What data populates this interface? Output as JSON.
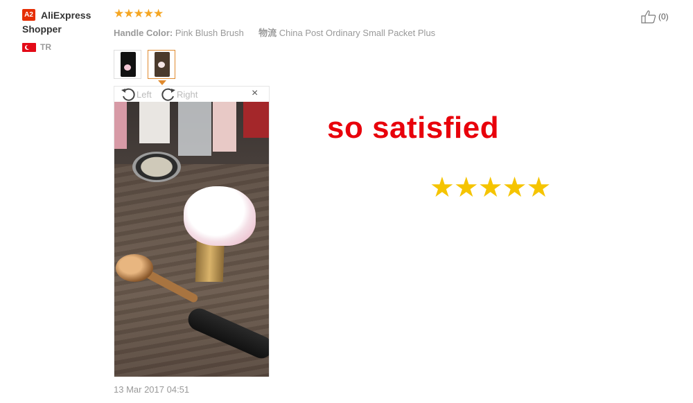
{
  "reviewer": {
    "badge": "A2",
    "name": "AliExpress Shopper",
    "country_code": "TR"
  },
  "review": {
    "stars": "★★★★★",
    "rating": 5,
    "attr_key": "Handle Color:",
    "attr_value": "Pink Blush Brush",
    "logistics_key": "物流",
    "logistics_value": "China Post Ordinary Small Packet Plus",
    "date": "13 Mar 2017 04:51"
  },
  "helpful": {
    "count": "(0)",
    "icon": "thumbs-up-icon"
  },
  "viewer": {
    "rotate_left": "Left",
    "rotate_right": "Right",
    "close": "×",
    "thumbnails": 2,
    "selected_thumbnail": 2
  },
  "overlay": {
    "caption": "so satisfied",
    "stars": "★★★★★"
  },
  "colors": {
    "star_orange": "#f5a623",
    "caption_red": "#e8000b",
    "overlay_star_yellow": "#f5c400",
    "selected_thumb_border": "#e08a2e"
  }
}
